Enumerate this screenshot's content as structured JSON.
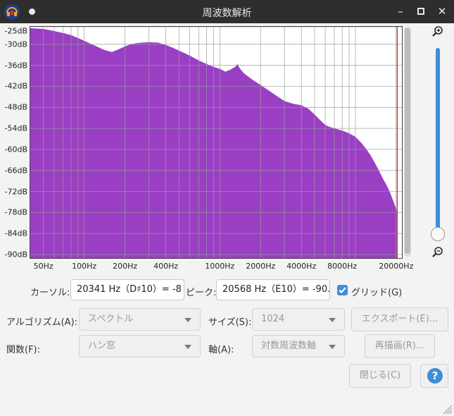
{
  "window": {
    "title": "周波数解析"
  },
  "colors": {
    "spectrum": "#9a3fc4",
    "cursor_line": "#d62020",
    "grid": "#9a9a9a",
    "accent": "#3d8fd6"
  },
  "icons": {
    "app": "audacity-icon",
    "zoom_in": "zoom-in-icon",
    "zoom_out": "zoom-out-icon",
    "help": "help-icon",
    "check": "checkmark-icon",
    "resize": "resize-grip-icon"
  },
  "chart_data": {
    "type": "area",
    "xscale": "log",
    "xlim": [
      40,
      22050
    ],
    "ylim": [
      -91,
      -25
    ],
    "yticks": [
      {
        "value": -25,
        "label": "-25dB"
      },
      {
        "value": -30,
        "label": "-30dB"
      },
      {
        "value": -36,
        "label": "-36dB"
      },
      {
        "value": -42,
        "label": "-42dB"
      },
      {
        "value": -48,
        "label": "-48dB"
      },
      {
        "value": -54,
        "label": "-54dB"
      },
      {
        "value": -60,
        "label": "-60dB"
      },
      {
        "value": -66,
        "label": "-66dB"
      },
      {
        "value": -72,
        "label": "-72dB"
      },
      {
        "value": -78,
        "label": "-78dB"
      },
      {
        "value": -84,
        "label": "-84dB"
      },
      {
        "value": -90,
        "label": "-90dB"
      }
    ],
    "xticks": [
      {
        "value": 50,
        "label": "50Hz"
      },
      {
        "value": 100,
        "label": "100Hz"
      },
      {
        "value": 200,
        "label": "200Hz"
      },
      {
        "value": 400,
        "label": "400Hz"
      },
      {
        "value": 1000,
        "label": "1000Hz"
      },
      {
        "value": 2000,
        "label": "2000Hz"
      },
      {
        "value": 4000,
        "label": "4000Hz"
      },
      {
        "value": 8000,
        "label": "8000Hz"
      },
      {
        "value": 20000,
        "label": "20000Hz"
      }
    ],
    "grid": true,
    "cursor_hz": 20341,
    "points": [
      [
        40,
        -25.4
      ],
      [
        50,
        -25.6
      ],
      [
        60,
        -26.2
      ],
      [
        70,
        -26.8
      ],
      [
        80,
        -27.4
      ],
      [
        90,
        -28.2
      ],
      [
        100,
        -29.0
      ],
      [
        120,
        -30.4
      ],
      [
        140,
        -31.6
      ],
      [
        160,
        -32.2
      ],
      [
        180,
        -31.4
      ],
      [
        200,
        -30.6
      ],
      [
        220,
        -30.0
      ],
      [
        250,
        -29.6
      ],
      [
        300,
        -29.4
      ],
      [
        350,
        -29.5
      ],
      [
        400,
        -30.2
      ],
      [
        450,
        -31.0
      ],
      [
        500,
        -31.8
      ],
      [
        600,
        -33.2
      ],
      [
        700,
        -34.6
      ],
      [
        800,
        -35.6
      ],
      [
        900,
        -36.4
      ],
      [
        1000,
        -37.0
      ],
      [
        1100,
        -37.8
      ],
      [
        1200,
        -37.2
      ],
      [
        1300,
        -36.4
      ],
      [
        1350,
        -35.6
      ],
      [
        1400,
        -36.8
      ],
      [
        1500,
        -38.2
      ],
      [
        1700,
        -39.8
      ],
      [
        2000,
        -41.6
      ],
      [
        2300,
        -43.2
      ],
      [
        2600,
        -44.6
      ],
      [
        3000,
        -46.2
      ],
      [
        3500,
        -47.0
      ],
      [
        4000,
        -47.4
      ],
      [
        4500,
        -48.4
      ],
      [
        5000,
        -50.0
      ],
      [
        5500,
        -51.6
      ],
      [
        6000,
        -53.0
      ],
      [
        6500,
        -53.6
      ],
      [
        7000,
        -54.0
      ],
      [
        8000,
        -54.6
      ],
      [
        9000,
        -55.4
      ],
      [
        10000,
        -56.4
      ],
      [
        11000,
        -58.0
      ],
      [
        12000,
        -59.8
      ],
      [
        13000,
        -61.8
      ],
      [
        14000,
        -64.0
      ],
      [
        15000,
        -66.2
      ],
      [
        16000,
        -68.4
      ],
      [
        17000,
        -70.2
      ],
      [
        18000,
        -72.2
      ],
      [
        19000,
        -74.6
      ],
      [
        20000,
        -77.0
      ],
      [
        20341,
        -77.8
      ]
    ]
  },
  "controls": {
    "cursor_label": "カーソル:",
    "cursor_value": "20341 Hz（D♯10）= -8",
    "peak_label": "ピーク:",
    "peak_value": "20568 Hz（E10）= -90.",
    "grid_label": "グリッド(G)",
    "grid_checked": true,
    "algorithm_label": "アルゴリズム(A):",
    "algorithm_value": "スペクトル",
    "size_label": "サイズ(S):",
    "size_value": "1024",
    "export_button": "エクスポート(E)...",
    "function_label": "関数(F):",
    "function_value": "ハン窓",
    "axis_label": "軸(A):",
    "axis_value": "対数周波数軸",
    "redraw_button": "再描画(R)...",
    "close_button": "閉じる(C)",
    "help_symbol": "?"
  }
}
